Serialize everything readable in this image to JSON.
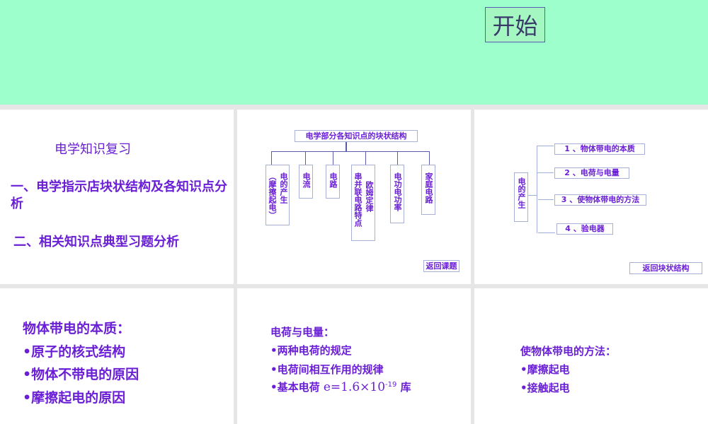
{
  "banner": {
    "start_label": "开始"
  },
  "slide1": {
    "title": "电学知识复习",
    "item1": "一、电学指示店块状结构及各知识点分析",
    "item2": "二、相关知识点典型习题分析"
  },
  "slide2": {
    "title": "电学部分各知识点的块状结构",
    "blocks": [
      {
        "cols": [
          "（摩擦起电）",
          "电的产生"
        ]
      },
      {
        "cols": [
          "电流"
        ]
      },
      {
        "cols": [
          "电路"
        ]
      },
      {
        "cols": [
          "串并联电路特点",
          "欧姆定律"
        ]
      },
      {
        "cols": [
          "电功电功率"
        ]
      },
      {
        "cols": [
          "家庭电路"
        ]
      }
    ],
    "back_label": "返回课题"
  },
  "slide3": {
    "root": "电的产生",
    "items": [
      "1 、物体带电的本质",
      "2 、电荷与电量",
      "3 、使物体带电的方法",
      "4 、验电器"
    ],
    "back_label": "返回块状结构"
  },
  "slide4": {
    "title": "物体带电的本质：",
    "items": [
      "•原子的核式结构",
      "•物体不带电的原因",
      "•摩擦起电的原因"
    ]
  },
  "slide5": {
    "title": "电荷与电量：",
    "items": [
      "•两种电荷的规定",
      "•电荷间相互作用的规律"
    ],
    "item3_prefix": "•基本电荷",
    "item3_formula": "e=1.6×10",
    "item3_exp": "-19",
    "item3_unit": "库"
  },
  "slide6": {
    "title": "使物体带电的方法：",
    "items": [
      "•摩擦起电",
      "•接触起电"
    ]
  }
}
